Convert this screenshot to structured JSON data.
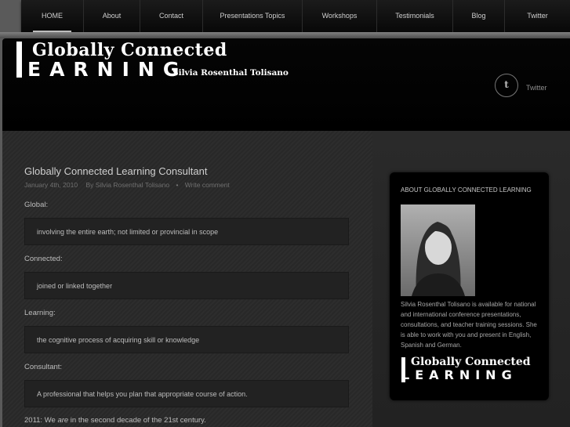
{
  "nav": {
    "items": [
      {
        "label": "HOME",
        "active": true
      },
      {
        "label": "About"
      },
      {
        "label": "Contact"
      },
      {
        "label": "Presentations Topics"
      },
      {
        "label": "Workshops"
      },
      {
        "label": "Testimonials"
      },
      {
        "label": "Blog"
      },
      {
        "label": "Twitter"
      }
    ]
  },
  "header": {
    "logo_top": "Globally Connected",
    "logo_bottom": "EARNING",
    "author": "Silvia Rosenthal Tolisano",
    "twitter_icon": "t",
    "twitter_label": "Twitter"
  },
  "post": {
    "title": "Globally Connected Learning Consultant",
    "date": "January 4th, 2010",
    "author": "By Silvia Rosenthal Tolisano",
    "bullet": "•",
    "comment_link": "Write comment",
    "definitions": [
      {
        "term": "Global:",
        "definition": "involving the entire earth; not limited or provincial in scope"
      },
      {
        "term": "Connected:",
        "definition": "joined or linked together"
      },
      {
        "term": "Learning:",
        "definition": "the cognitive process of acquiring skill or knowledge"
      },
      {
        "term": "Consultant:",
        "definition": "A professional that helps you plan that appropriate course of action."
      }
    ],
    "closing_pre": "2011: We ",
    "closing_em": "are",
    "closing_post": " in the second decade of the 21st century."
  },
  "sidebar": {
    "title": "ABOUT GLOBALLY CONNECTED LEARNING",
    "bio": "Silvia Rosenthal Tolisano is available for national and international conference presentations, consultations, and teacher training sessions. She is able to work with you and present in English, Spanish and German.",
    "mini_logo_top": "Globally Connected",
    "mini_logo_bottom": "LEARNING"
  },
  "icons": {
    "twitter": "twitter-icon",
    "logo": "globe-logo"
  }
}
